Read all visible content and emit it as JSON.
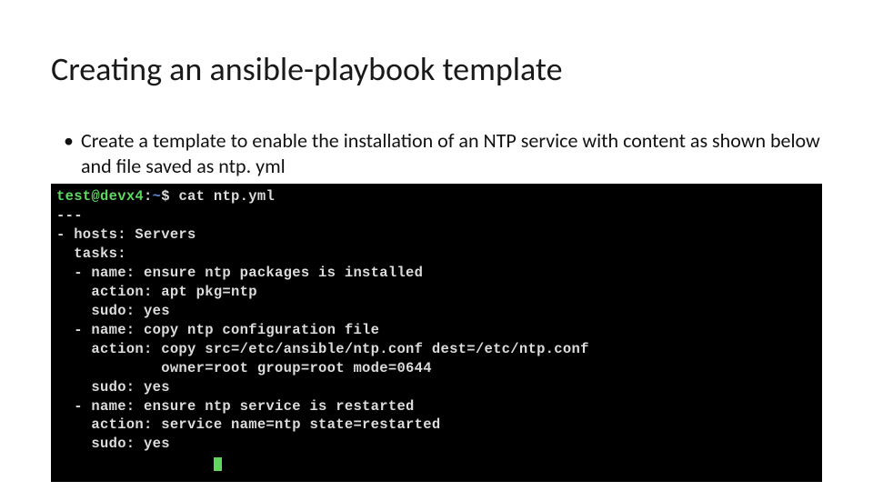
{
  "title": "Creating an ansible-playbook template",
  "bullet": "Create a template to enable the installation of an NTP service with content as shown below and file saved as ntp. yml",
  "terminal": {
    "prompt_user": "test",
    "prompt_at": "@",
    "prompt_host": "devx4",
    "prompt_sep": ":",
    "prompt_tilde": "~",
    "prompt_dollar": "$ ",
    "cmd": "cat ntp.yml",
    "lines": [
      "---",
      "- hosts: Servers",
      "  tasks:",
      "  - name: ensure ntp packages is installed",
      "    action: apt pkg=ntp",
      "    sudo: yes",
      "  - name: copy ntp configuration file",
      "    action: copy src=/etc/ansible/ntp.conf dest=/etc/ntp.conf",
      "            owner=root group=root mode=0644",
      "    sudo: yes",
      "  - name: ensure ntp service is restarted",
      "    action: service name=ntp state=restarted",
      "    sudo: yes"
    ]
  }
}
